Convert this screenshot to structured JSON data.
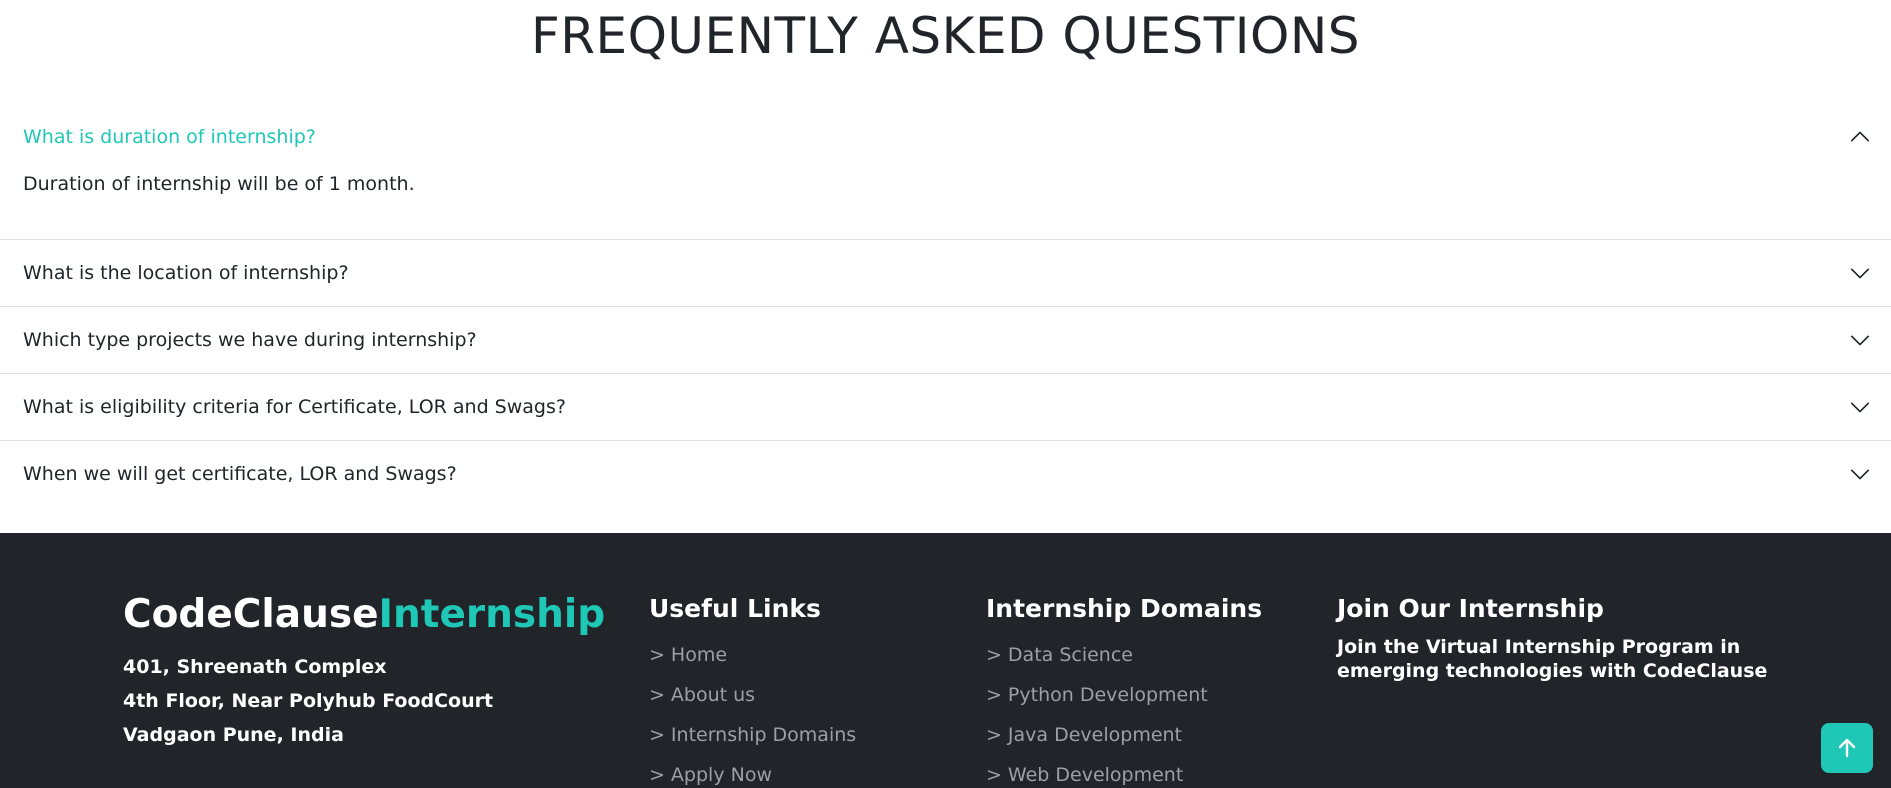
{
  "faq": {
    "title": "FREQUENTLY ASKED QUESTIONS",
    "items": [
      {
        "question": "What is duration of internship?",
        "answer": "Duration of internship will be of 1 month.",
        "expanded": true
      },
      {
        "question": "What is the location of internship?",
        "expanded": false
      },
      {
        "question": "Which type projects we have during internship?",
        "expanded": false
      },
      {
        "question": "What is eligibility criteria for Certificate, LOR and Swags?",
        "expanded": false
      },
      {
        "question": "When we will get certificate, LOR and Swags?",
        "expanded": false
      }
    ]
  },
  "footer": {
    "brand": {
      "primary": "CodeClause",
      "accent": "Internship"
    },
    "address": [
      "401, Shreenath Complex",
      "4th Floor, Near Polyhub FoodCourt",
      "Vadgaon Pune, India"
    ],
    "useful_links": {
      "heading": "Useful Links",
      "items": [
        "Home",
        "About us",
        "Internship Domains",
        "Apply Now"
      ]
    },
    "domains": {
      "heading": "Internship Domains",
      "items": [
        "Data Science",
        "Python Development",
        "Java Development",
        "Web Development"
      ]
    },
    "join": {
      "heading": "Join Our Internship",
      "text": "Join the Virtual Internship Program in emerging technologies with CodeClause"
    },
    "link_prefix": ">"
  },
  "icons": {
    "collapse": "chevron-up-icon",
    "expand": "chevron-down-icon",
    "back_to_top": "arrow-up-icon"
  },
  "colors": {
    "accent": "#1fc8b6",
    "footer_bg": "#212529",
    "text": "#212529",
    "muted_link": "#9aa0a6"
  }
}
